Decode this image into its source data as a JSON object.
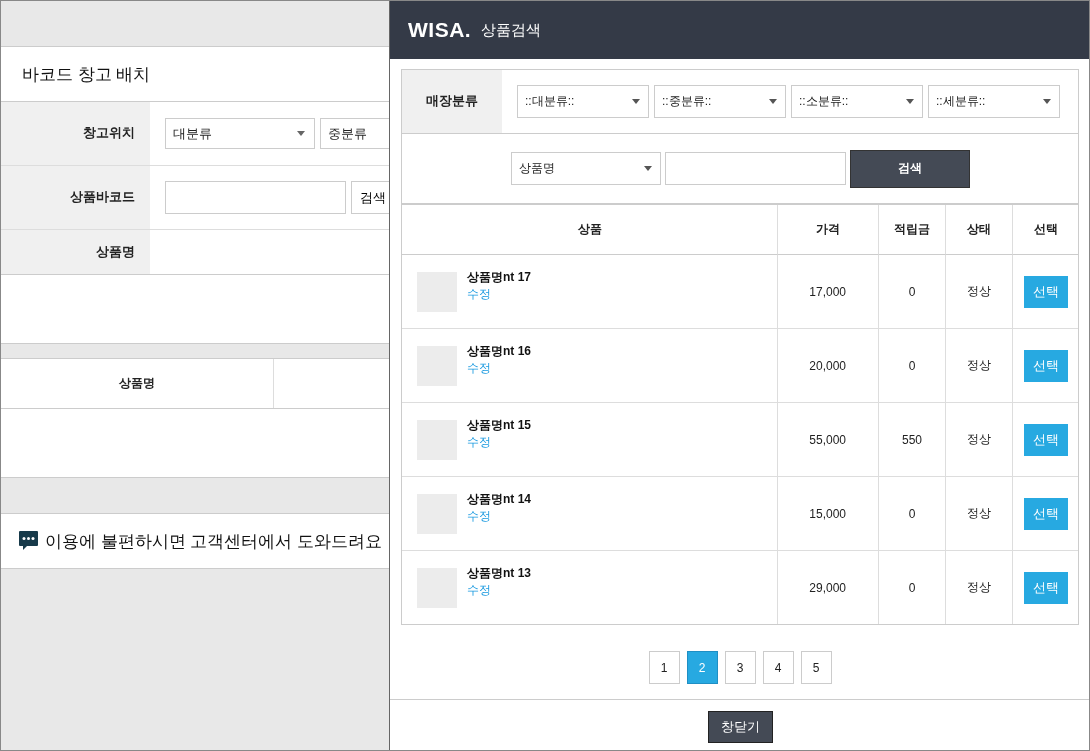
{
  "background_page": {
    "title": "바코드 창고 배치",
    "form": [
      {
        "kind": "selects",
        "label": "창고위치",
        "selects": [
          "대분류",
          "중분류"
        ]
      },
      {
        "kind": "search",
        "label": "상품바코드",
        "button": "검색"
      },
      {
        "kind": "text",
        "label": "상품명"
      }
    ],
    "table": {
      "columns": [
        "상품명"
      ]
    },
    "help_text": "이용에 불편하시면 고객센터에서 도와드려요"
  },
  "popup": {
    "logo": "WISA.",
    "title": "상품검색",
    "category_label": "매장분류",
    "category_selects": [
      "::대분류::",
      "::중분류::",
      "::소분류::",
      "::세분류::"
    ],
    "search": {
      "field_select": "상품명",
      "button": "검색"
    },
    "table": {
      "columns": [
        "상품",
        "가격",
        "적립금",
        "상태",
        "선택"
      ],
      "rows": [
        {
          "name": "상품명nt 17",
          "edit_link": "수정",
          "price": "17,000",
          "points": "0",
          "status": "정상",
          "action": "선택"
        },
        {
          "name": "상품명nt 16",
          "edit_link": "수정",
          "price": "20,000",
          "points": "0",
          "status": "정상",
          "action": "선택"
        },
        {
          "name": "상품명nt 15",
          "edit_link": "수정",
          "price": "55,000",
          "points": "550",
          "status": "정상",
          "action": "선택"
        },
        {
          "name": "상품명nt 14",
          "edit_link": "수정",
          "price": "15,000",
          "points": "0",
          "status": "정상",
          "action": "선택"
        },
        {
          "name": "상품명nt 13",
          "edit_link": "수정",
          "price": "29,000",
          "points": "0",
          "status": "정상",
          "action": "선택"
        }
      ]
    },
    "pagination": [
      {
        "label": "1",
        "selected": false
      },
      {
        "label": "2",
        "selected": true
      },
      {
        "label": "3",
        "selected": false
      },
      {
        "label": "4",
        "selected": false
      },
      {
        "label": "5",
        "selected": false
      }
    ],
    "close_button": "창닫기"
  }
}
